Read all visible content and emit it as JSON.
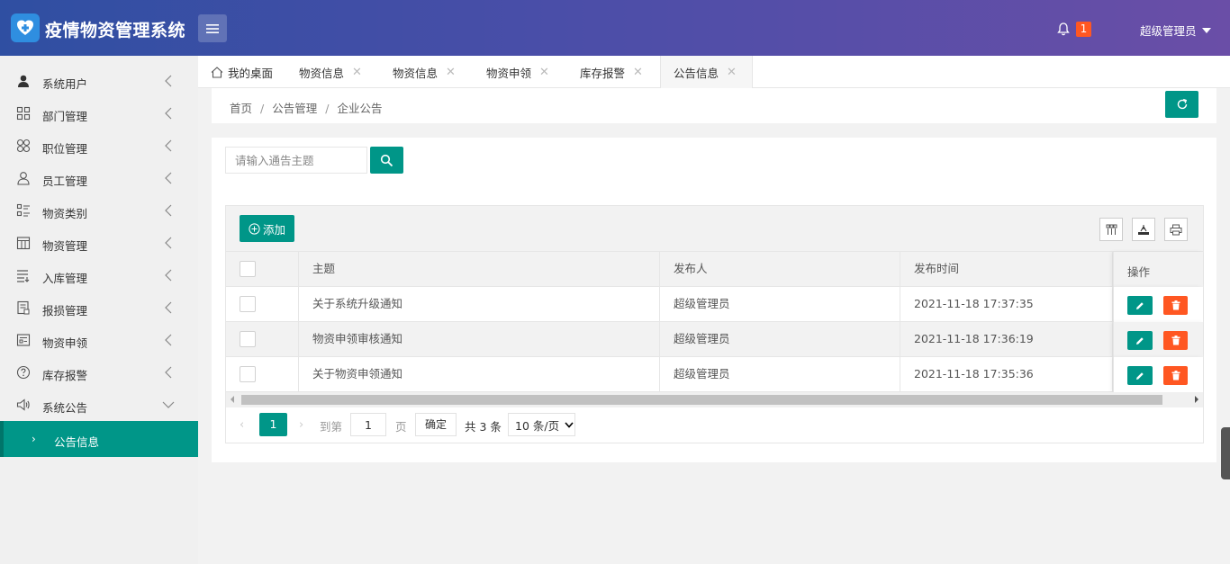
{
  "header": {
    "app_title": "疫情物资管理系统",
    "notification_count": "1",
    "user_name": "超级管理员",
    "colors": {
      "gradient_start": "#2f4fa2",
      "gradient_end": "#6a4ea7",
      "badge": "#ff5722"
    }
  },
  "sidebar": {
    "items": [
      {
        "label": "系统用户",
        "icon": "user-icon"
      },
      {
        "label": "部门管理",
        "icon": "grid-icon"
      },
      {
        "label": "职位管理",
        "icon": "clover-icon"
      },
      {
        "label": "员工管理",
        "icon": "person-icon"
      },
      {
        "label": "物资类别",
        "icon": "list-icon"
      },
      {
        "label": "物资管理",
        "icon": "calendar-icon"
      },
      {
        "label": "入库管理",
        "icon": "inbox-list-icon"
      },
      {
        "label": "报损管理",
        "icon": "doc-icon"
      },
      {
        "label": "物资申领",
        "icon": "form-icon"
      },
      {
        "label": "库存报警",
        "icon": "help-icon"
      },
      {
        "label": "系统公告",
        "icon": "speaker-icon"
      }
    ],
    "active_sub": "公告信息",
    "accent": "#009688"
  },
  "tabs": [
    {
      "label": "我的桌面",
      "closable": false
    },
    {
      "label": "物资信息",
      "closable": true
    },
    {
      "label": "物资信息",
      "closable": true
    },
    {
      "label": "物资申领",
      "closable": true
    },
    {
      "label": "库存报警",
      "closable": true
    },
    {
      "label": "公告信息",
      "closable": true,
      "active": true
    }
  ],
  "breadcrumb": [
    "首页",
    "公告管理",
    "企业公告"
  ],
  "search": {
    "placeholder": "请输入通告主题",
    "value": ""
  },
  "toolbar": {
    "add_label": "添加"
  },
  "table": {
    "columns": [
      "主题",
      "发布人",
      "发布时间",
      "操作"
    ],
    "rows": [
      {
        "subject": "关于系统升级通知",
        "publisher": "超级管理员",
        "time": "2021-11-18 17:37:35"
      },
      {
        "subject": "物资申领审核通知",
        "publisher": "超级管理员",
        "time": "2021-11-18 17:36:19"
      },
      {
        "subject": "关于物资申领通知",
        "publisher": "超级管理员",
        "time": "2021-11-18 17:35:36"
      }
    ]
  },
  "pager": {
    "current": "1",
    "goto_label": "到第",
    "goto_value": "1",
    "page_label": "页",
    "confirm_label": "确定",
    "total_text": "共 3 条",
    "page_size": "10 条/页"
  }
}
